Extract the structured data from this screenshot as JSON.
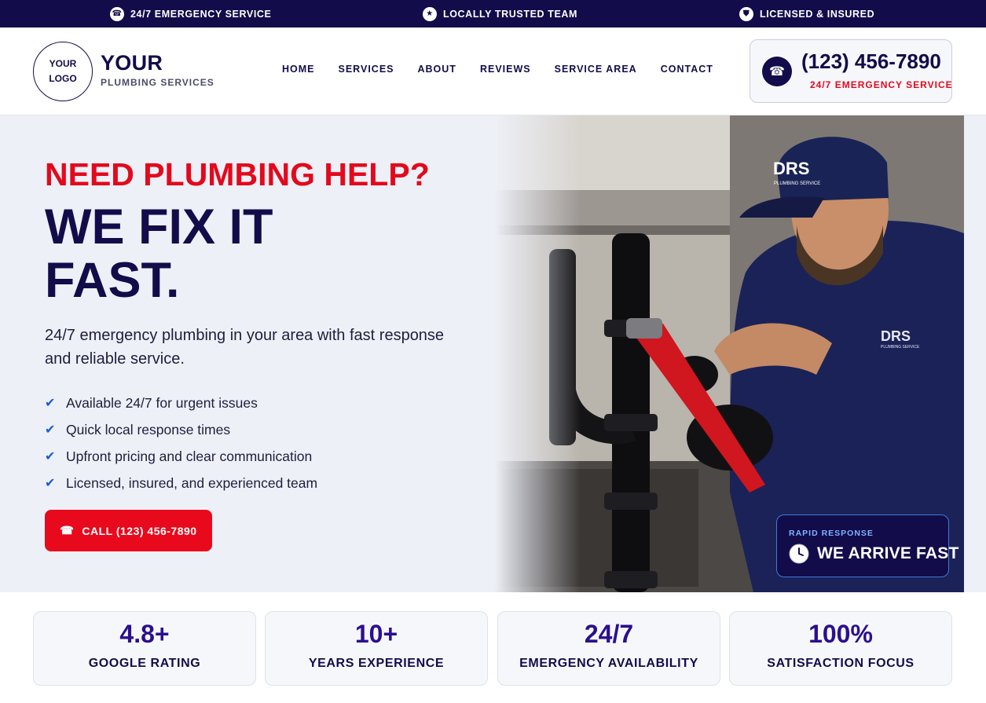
{
  "topbar": {
    "items": [
      {
        "icon": "phone-icon",
        "glyph": "☎",
        "label": "24/7 EMERGENCY SERVICE"
      },
      {
        "icon": "star-icon",
        "glyph": "★",
        "label": "LOCALLY TRUSTED TEAM"
      },
      {
        "icon": "shield-icon",
        "glyph": "⛊",
        "label": "LICENSED & INSURED"
      }
    ]
  },
  "header": {
    "logo_line1": "YOUR",
    "logo_line2": "LOGO",
    "brand_name": "YOUR",
    "brand_sub": "PLUMBING SERVICES",
    "nav": [
      "HOME",
      "SERVICES",
      "ABOUT",
      "REVIEWS",
      "SERVICE AREA",
      "CONTACT"
    ],
    "call": {
      "icon": "phone-icon",
      "number": "(123) 456-7890",
      "sub": "24/7 EMERGENCY SERVICE"
    }
  },
  "hero": {
    "kicker": "NEED PLUMBING HELP?",
    "headline_line1": "WE FIX IT",
    "headline_line2": "FAST.",
    "subtext": "24/7 emergency plumbing in your area with fast response and reliable service.",
    "features": [
      "Available 24/7 for urgent issues",
      "Quick local response times",
      "Upfront pricing and clear communication",
      "Licensed, insured, and experienced team"
    ],
    "cta_label": "CALL (123) 456-7890",
    "cta_icon": "phone-icon",
    "photo_badge": {
      "label": "RAPID RESPONSE",
      "text": "WE ARRIVE FAST",
      "icon": "clock-icon"
    },
    "photo_text": {
      "cap_logo": "DRS",
      "cap_sub": "PLUMBING SERVICE",
      "shirt_logo": "DRS",
      "shirt_sub": "PLUMBING SERVICE"
    }
  },
  "stats": [
    {
      "value": "4.8+",
      "label": "GOOGLE RATING"
    },
    {
      "value": "10+",
      "label": "YEARS EXPERIENCE"
    },
    {
      "value": "24/7",
      "label": "EMERGENCY AVAILABILITY"
    },
    {
      "value": "100%",
      "label": "SATISFACTION FOCUS"
    }
  ],
  "colors": {
    "navy": "#120c4a",
    "red": "#e3091c",
    "check_blue": "#1a5bd1",
    "stat_purple": "#2b0f8f",
    "hero_bg": "#eef0f7"
  }
}
